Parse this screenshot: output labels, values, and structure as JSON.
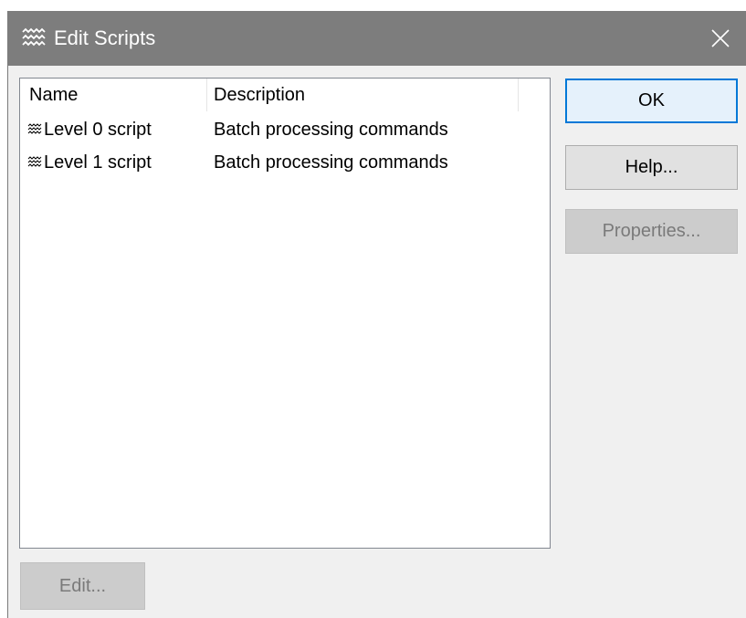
{
  "window": {
    "title": "Edit Scripts",
    "icon": "script-wave-icon",
    "close_icon": "close-icon"
  },
  "list": {
    "columns": [
      "Name",
      "Description"
    ],
    "rows": [
      {
        "icon": "script-wave-icon",
        "name": "Level 0 script",
        "description": "Batch processing commands"
      },
      {
        "icon": "script-wave-icon",
        "name": "Level 1 script",
        "description": "Batch processing commands"
      }
    ]
  },
  "buttons": {
    "ok": "OK",
    "help": "Help...",
    "properties": "Properties...",
    "edit": "Edit..."
  },
  "states": {
    "properties_enabled": false,
    "edit_enabled": false,
    "default_button": "ok"
  },
  "colors": {
    "titlebar": "#7d7d7d",
    "dialog_bg": "#f0f0f0",
    "accent": "#0078d7",
    "disabled_bg": "#cccccc"
  }
}
